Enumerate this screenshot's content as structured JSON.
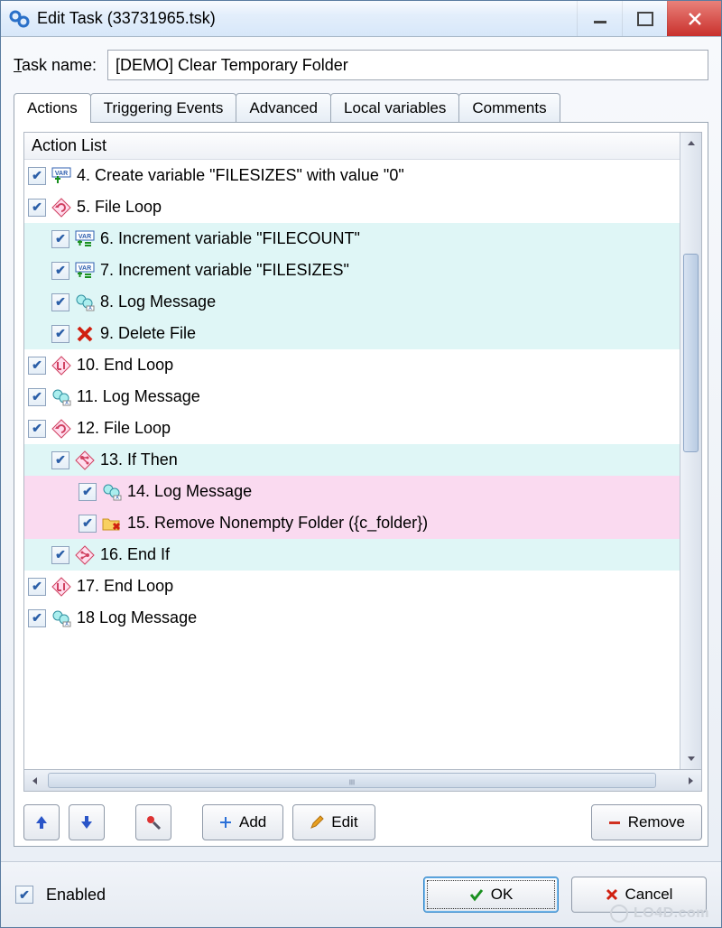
{
  "window": {
    "title": "Edit Task (33731965.tsk)"
  },
  "taskname": {
    "label": "Task name:",
    "value": "[DEMO] Clear Temporary Folder"
  },
  "tabs": [
    "Actions",
    "Triggering Events",
    "Advanced",
    "Local variables",
    "Comments"
  ],
  "list": {
    "header": "Action List",
    "items": [
      {
        "text": "4. Create variable \"FILESIZES\" with value \"0\"",
        "indent": 0,
        "bg": "",
        "icon": "var-add"
      },
      {
        "text": "5. File Loop",
        "indent": 0,
        "bg": "",
        "icon": "loop"
      },
      {
        "text": "6. Increment variable \"FILECOUNT\"",
        "indent": 1,
        "bg": "cyan",
        "icon": "var-inc"
      },
      {
        "text": "7. Increment variable \"FILESIZES\"",
        "indent": 1,
        "bg": "cyan",
        "icon": "var-inc"
      },
      {
        "text": "8. Log Message",
        "indent": 1,
        "bg": "cyan",
        "icon": "log"
      },
      {
        "text": "9. Delete File",
        "indent": 1,
        "bg": "cyan",
        "icon": "delete"
      },
      {
        "text": "10. End Loop",
        "indent": 0,
        "bg": "",
        "icon": "endloop"
      },
      {
        "text": "11. Log Message",
        "indent": 0,
        "bg": "",
        "icon": "log"
      },
      {
        "text": "12. File Loop",
        "indent": 0,
        "bg": "",
        "icon": "loop"
      },
      {
        "text": "13. If Then",
        "indent": 1,
        "bg": "cyan",
        "icon": "if"
      },
      {
        "text": "14. Log Message",
        "indent": 2,
        "bg": "pink",
        "icon": "log"
      },
      {
        "text": "15. Remove Nonempty Folder  ({c_folder})",
        "indent": 2,
        "bg": "pink",
        "icon": "folder-del"
      },
      {
        "text": "16. End If",
        "indent": 1,
        "bg": "cyan",
        "icon": "endif"
      },
      {
        "text": "17. End Loop",
        "indent": 0,
        "bg": "",
        "icon": "endloop"
      },
      {
        "text": "18  Log Message",
        "indent": 0,
        "bg": "",
        "icon": "log"
      }
    ]
  },
  "toolbar": {
    "add": "Add",
    "edit": "Edit",
    "remove": "Remove"
  },
  "bottom": {
    "enabled": "Enabled",
    "ok": "OK",
    "cancel": "Cancel"
  },
  "watermark": "LO4D.com"
}
